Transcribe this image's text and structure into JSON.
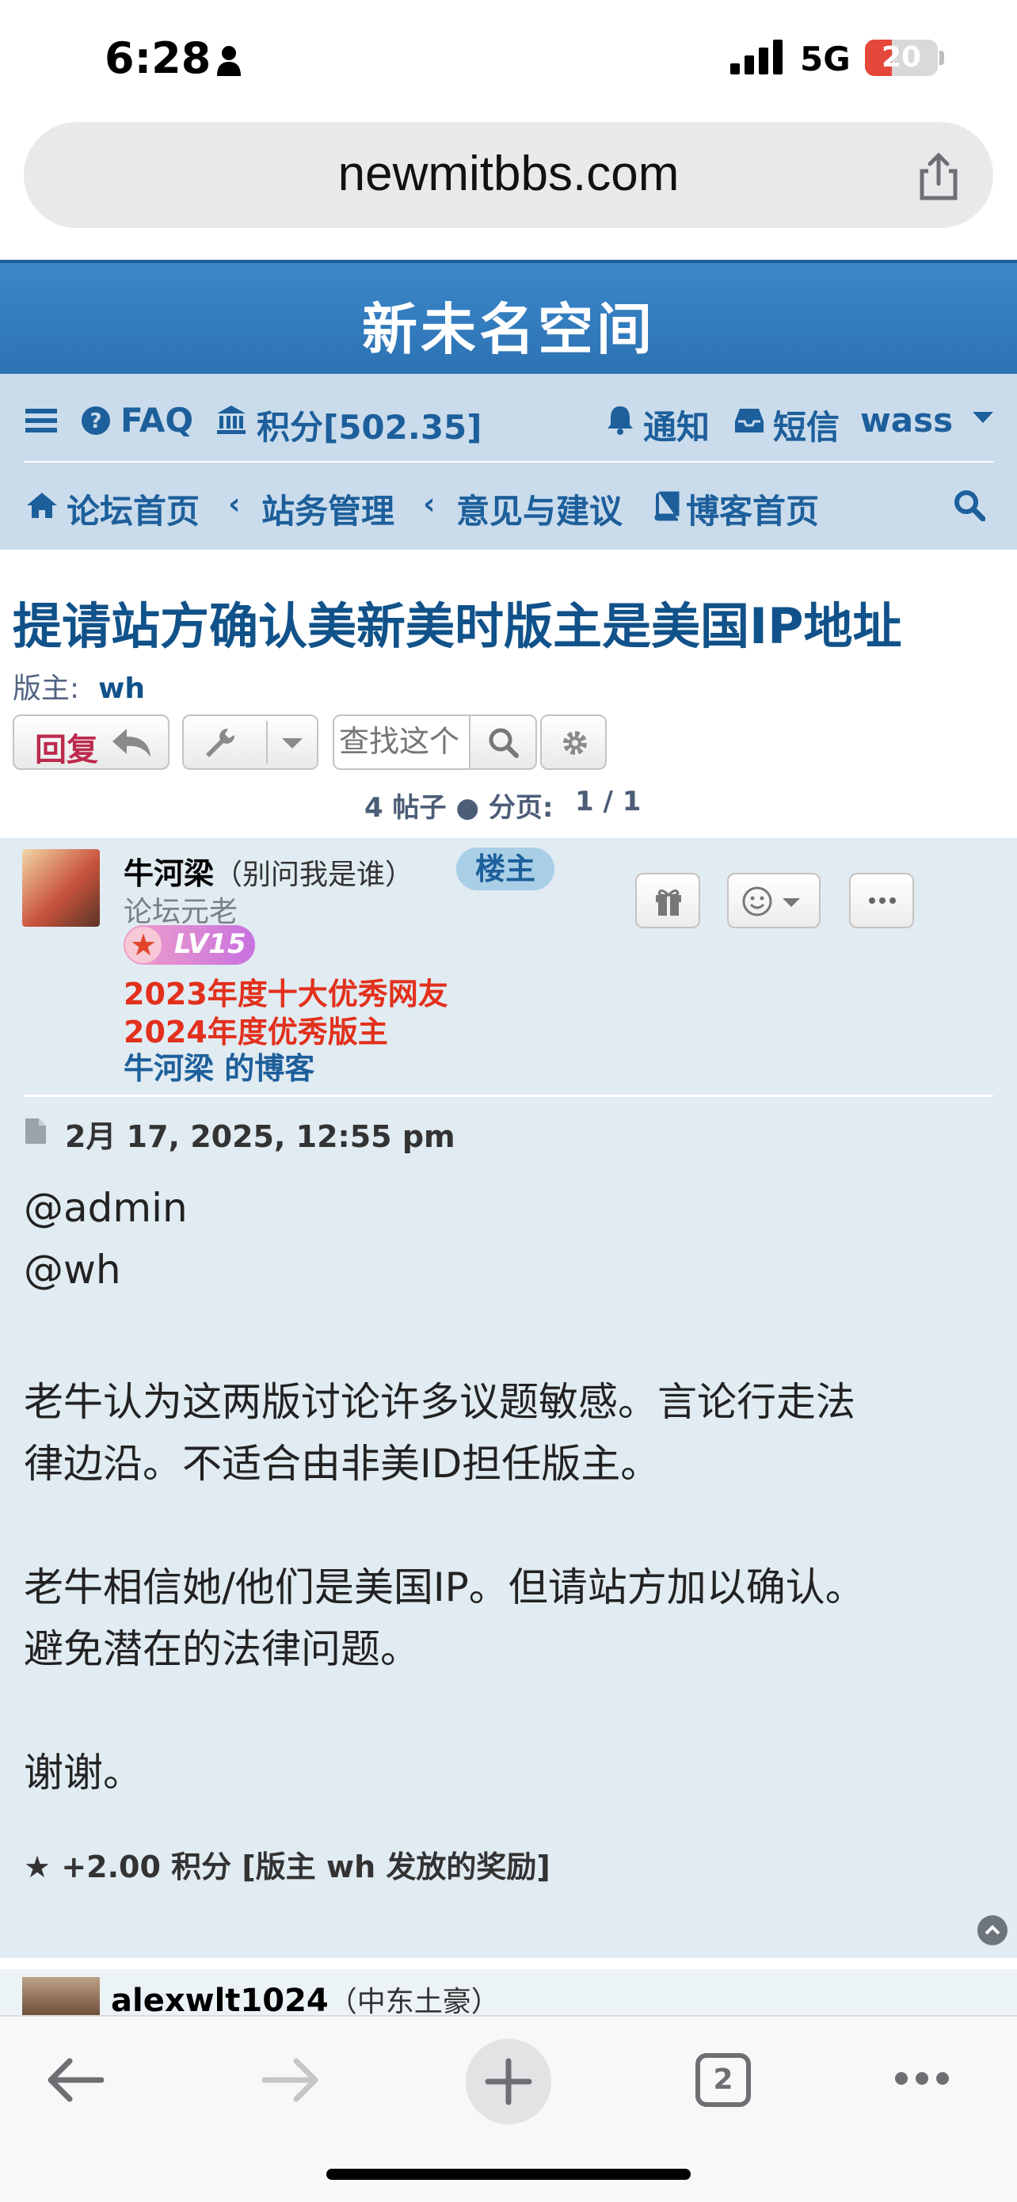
{
  "status_bar": {
    "time": "6:28",
    "network": "5G",
    "battery": "20"
  },
  "browser": {
    "url": "newmitbbs.com",
    "tab_count": "2"
  },
  "site": {
    "title": "新未名空间"
  },
  "nav": {
    "faq": "FAQ",
    "points": "积分[502.35]",
    "notifications": "通知",
    "messages": "短信",
    "username": "wass",
    "breadcrumb": [
      "论坛首页",
      "站务管理",
      "意见与建议"
    ],
    "blog_home": "博客首页"
  },
  "topic": {
    "title": "提请站方确认美新美时版主是美国IP地址",
    "moderators_label": "版主:",
    "moderator": "wh",
    "reply_label": "回复",
    "search_placeholder": "查找这个",
    "post_count": "4 帖子",
    "page_label": "分页:",
    "page": "1 / 1"
  },
  "post": {
    "author": "牛河梁",
    "author_note": "（别问我是谁）",
    "op_badge": "楼主",
    "rank": "论坛元老",
    "level": "LV15",
    "awards": [
      "2023年度十大优秀网友",
      "2024年度优秀版主"
    ],
    "blog_link": "牛河梁 的博客",
    "date": "2月 17, 2025, 12:55 pm",
    "lines": [
      "@admin",
      "@wh",
      "",
      "老牛认为这两版讨论许多议题敏感。言论行走法",
      "律边沿。不适合由非美ID担任版主。",
      "",
      "老牛相信她/他们是美国IP。但请站方加以确认。",
      "避免潜在的法律问题。",
      "",
      "谢谢。"
    ],
    "reward": "+2.00 积分 [版主 wh 发放的奖励]"
  },
  "next_post": {
    "author": "alexwlt1024",
    "author_note": "（中东土豪）"
  },
  "colors": {
    "header_blue": "#2c72b3",
    "nav_bg": "#cadcec",
    "link_blue": "#1d5f9b",
    "post_bg": "#e1ebf2",
    "award_red": "#e2301c",
    "reply_red": "#bc2a4d"
  }
}
